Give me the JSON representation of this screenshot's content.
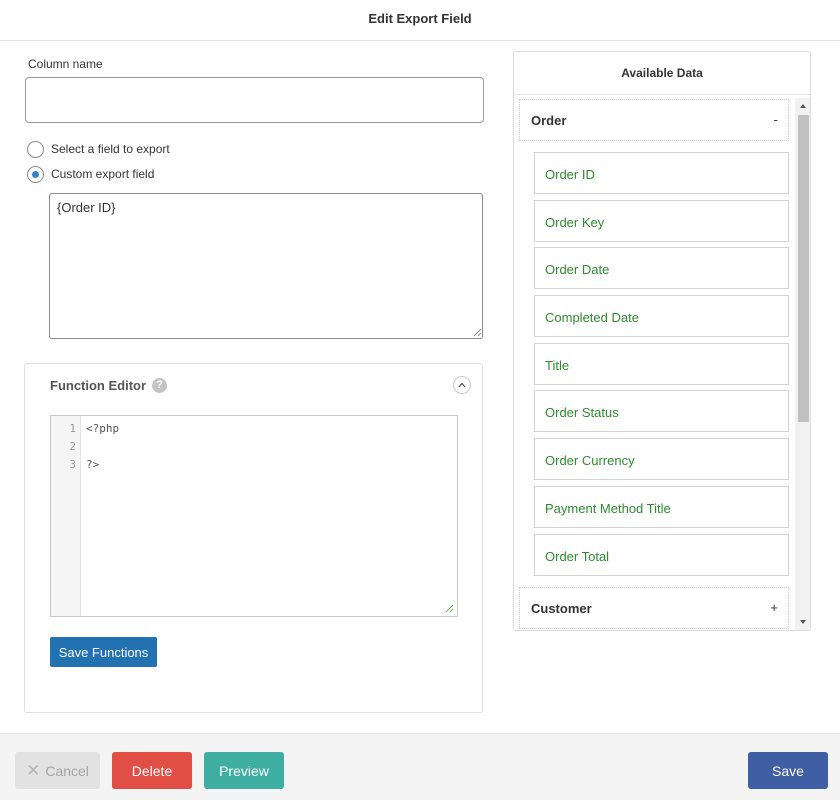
{
  "dialog": {
    "title": "Edit Export Field"
  },
  "column": {
    "label": "Column name",
    "value": ""
  },
  "export_mode": {
    "options": [
      "Select a field to export",
      "Custom export field"
    ],
    "selected": "Custom export field"
  },
  "custom_field": {
    "value": "{Order ID}"
  },
  "function_editor": {
    "title": "Function Editor",
    "help_glyph": "?",
    "line_numbers": [
      "1",
      "2",
      "3"
    ],
    "code_lines": [
      "<?php",
      "",
      "?>"
    ],
    "save_label": "Save Functions"
  },
  "available_data": {
    "title": "Available Data",
    "groups": [
      {
        "label": "Order",
        "toggle": "-",
        "fields": [
          "Order ID",
          "Order Key",
          "Order Date",
          "Completed Date",
          "Title",
          "Order Status",
          "Order Currency",
          "Payment Method Title",
          "Order Total"
        ]
      },
      {
        "label": "Customer",
        "toggle": "+",
        "fields": []
      }
    ]
  },
  "footer": {
    "cancel_label": "Cancel",
    "delete_label": "Delete",
    "preview_label": "Preview",
    "save_label": "Save"
  },
  "colors": {
    "field_text": "#2e8b2e",
    "delete": "#e04e45",
    "preview": "#3fafa3",
    "save": "#3f5ea3",
    "save_functions": "#2271b1"
  }
}
